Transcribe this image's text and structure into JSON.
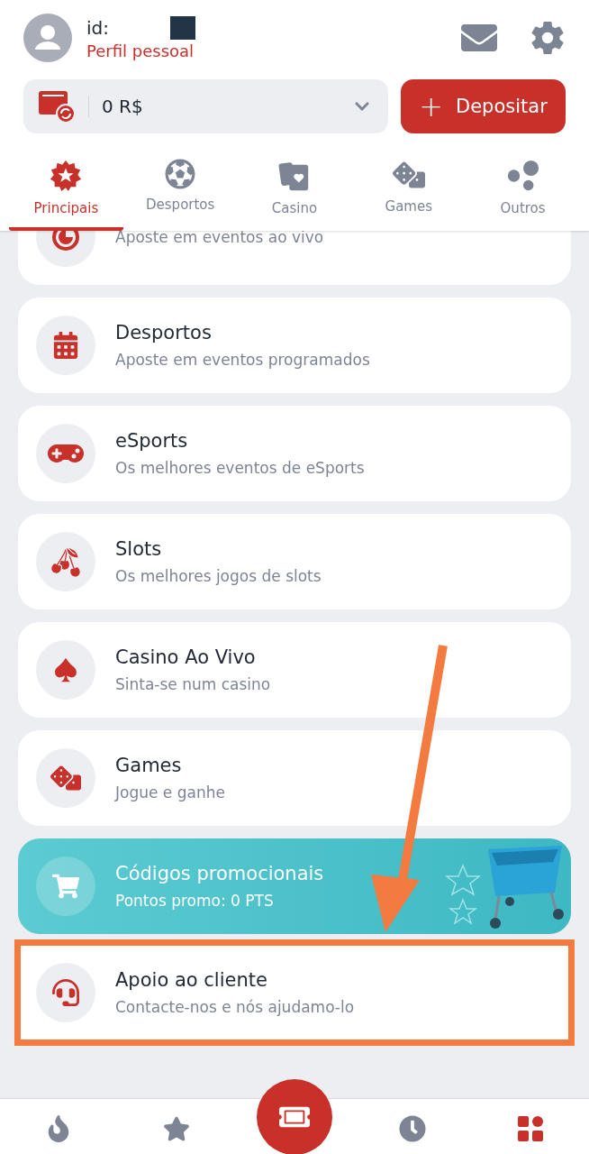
{
  "header": {
    "id_label": "id:",
    "profile_link": "Perfil pessoal"
  },
  "balance": {
    "amount": "0 R$"
  },
  "deposit_button": {
    "label": "Depositar",
    "icon": "+"
  },
  "tabs": [
    {
      "label": "Principais",
      "kind": "star",
      "selected": true
    },
    {
      "label": "Desportos",
      "kind": "ball",
      "selected": false
    },
    {
      "label": "Casino",
      "kind": "cards",
      "selected": false
    },
    {
      "label": "Games",
      "kind": "dice",
      "selected": false
    },
    {
      "label": "Outros",
      "kind": "dots",
      "selected": false
    }
  ],
  "menu_items": [
    {
      "kind": "live",
      "subtitle": "Aposte em eventos ao vivo",
      "highlighted": false
    },
    {
      "kind": "calendar",
      "title": "Desportos",
      "subtitle": "Aposte em eventos programados",
      "highlighted": false
    },
    {
      "kind": "gamepad",
      "title": "eSports",
      "subtitle": "Os melhores eventos de eSports",
      "highlighted": false
    },
    {
      "kind": "cherries",
      "title": "Slots",
      "subtitle": "Os melhores jogos de slots",
      "highlighted": false
    },
    {
      "kind": "spade",
      "title": "Casino Ao Vivo",
      "subtitle": "Sinta-se num casino",
      "highlighted": false
    },
    {
      "kind": "dice",
      "title": "Games",
      "subtitle": "Jogue e ganhe",
      "highlighted": false
    },
    {
      "kind": "promo",
      "title": "Códigos promocionais",
      "subtitle": "Pontos promo: 0 PTS",
      "highlighted": false
    },
    {
      "kind": "headset",
      "title": "Apoio ao cliente",
      "subtitle": "Contacte-nos e nós ajudamo-lo",
      "highlighted": true
    }
  ],
  "bottom_nav": [
    {
      "kind": "fire",
      "selected": false
    },
    {
      "kind": "star",
      "selected": false
    },
    {
      "kind": "ticket",
      "selected": false
    },
    {
      "kind": "clock",
      "selected": false
    },
    {
      "kind": "grid",
      "selected": true
    }
  ]
}
